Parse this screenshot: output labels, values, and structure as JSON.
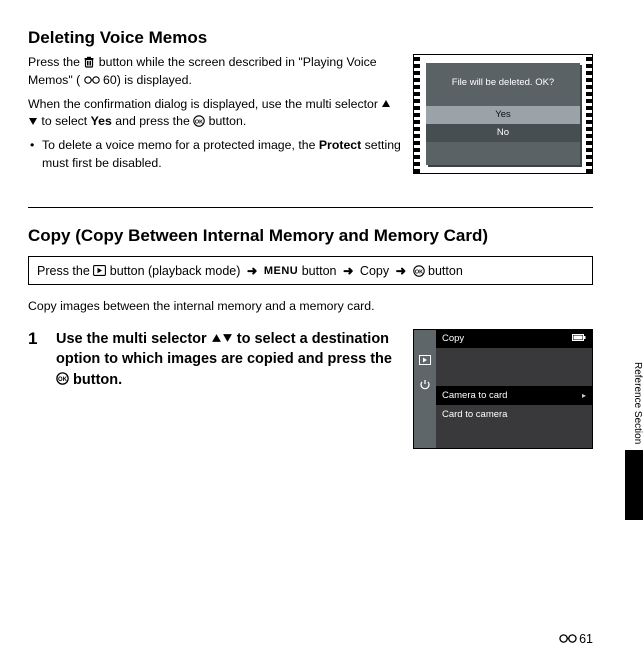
{
  "section1": {
    "heading": "Deleting Voice Memos",
    "p1a": "Press the ",
    "p1b": " button while the screen described in \"Playing Voice Memos\" (",
    "p1c": "60) is displayed.",
    "p2a": "When the confirmation dialog is displayed, use the multi selector ",
    "p2b": " to select ",
    "p2_yes": "Yes",
    "p2c": " and press the ",
    "p2d": " button.",
    "b1a": "To delete a voice memo for a protected image, the ",
    "b1_protect": "Protect",
    "b1b": " setting must first be disabled."
  },
  "dialog": {
    "msg": "File will be deleted. OK?",
    "yes": "Yes",
    "no": "No"
  },
  "section2": {
    "heading": "Copy (Copy Between Internal Memory and Memory Card)",
    "path_a": "Press the ",
    "path_b": " button (playback mode) ",
    "path_menu": "MENU",
    "path_c": " button ",
    "path_copy": " Copy ",
    "path_ok": " button",
    "desc": "Copy images between the internal memory and a memory card.",
    "step_num": "1",
    "step_a": "Use the multi selector ",
    "step_b": " to select a destination option to which images are copied and press the ",
    "step_c": " button."
  },
  "menu": {
    "title": "Copy",
    "item1": "Camera to card",
    "item2": "Card to camera"
  },
  "side_label": "Reference Section",
  "page_num": "61"
}
